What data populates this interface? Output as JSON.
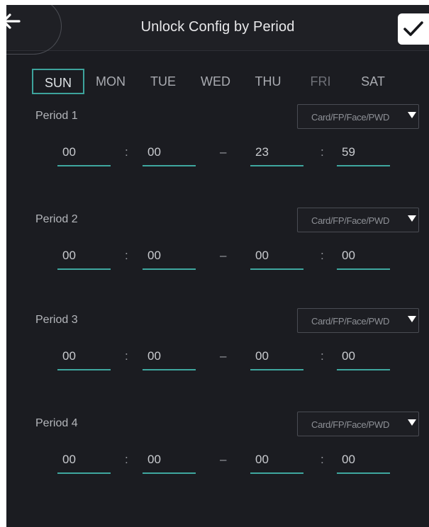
{
  "header": {
    "title": "Unlock Config by Period",
    "back_icon": "arrow-left-icon",
    "confirm_icon": "checkmark-icon"
  },
  "days": [
    "SUN",
    "MON",
    "TUE",
    "WED",
    "THU",
    "FRI",
    "SAT"
  ],
  "selected_day": "SUN",
  "separators": {
    "colon": ":",
    "dash": "–"
  },
  "periods": [
    {
      "label": "Period 1",
      "mode": "Card/FP/Face/PWD",
      "start_h": "00",
      "start_m": "00",
      "end_h": "23",
      "end_m": "59"
    },
    {
      "label": "Period 2",
      "mode": "Card/FP/Face/PWD",
      "start_h": "00",
      "start_m": "00",
      "end_h": "00",
      "end_m": "00"
    },
    {
      "label": "Period 3",
      "mode": "Card/FP/Face/PWD",
      "start_h": "00",
      "start_m": "00",
      "end_h": "00",
      "end_m": "00"
    },
    {
      "label": "Period 4",
      "mode": "Card/FP/Face/PWD",
      "start_h": "00",
      "start_m": "00",
      "end_h": "00",
      "end_m": "00"
    }
  ],
  "colors": {
    "background": "#1b1c21",
    "accent": "#3fa79f",
    "text": "#c9cbcf"
  }
}
